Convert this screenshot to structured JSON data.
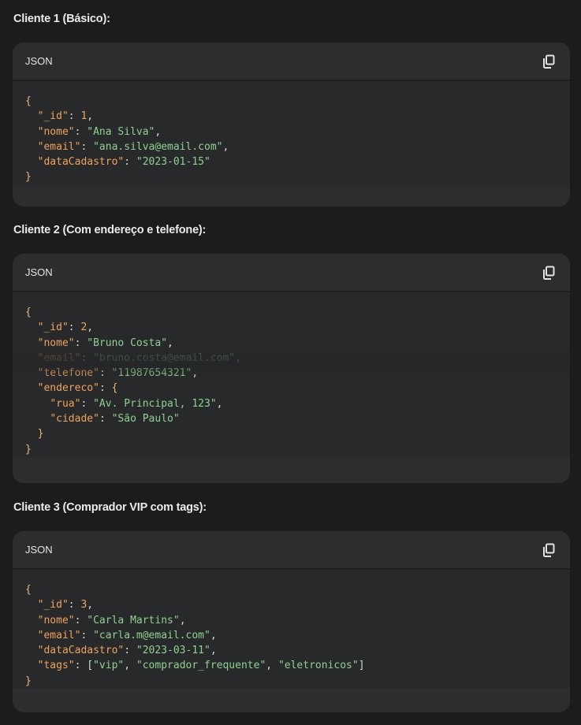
{
  "sections": [
    {
      "title": "Cliente 1 (Básico):",
      "lang": "JSON",
      "copy_icon": "copy-icon",
      "lines": [
        [
          {
            "t": "{",
            "c": "brace"
          }
        ],
        [
          {
            "t": "  "
          },
          {
            "t": "\"_id\"",
            "c": "k"
          },
          {
            "t": ": ",
            "c": "p"
          },
          {
            "t": "1",
            "c": "n"
          },
          {
            "t": ",",
            "c": "p"
          }
        ],
        [
          {
            "t": "  "
          },
          {
            "t": "\"nome\"",
            "c": "k"
          },
          {
            "t": ": ",
            "c": "p"
          },
          {
            "t": "\"Ana Silva\"",
            "c": "s"
          },
          {
            "t": ",",
            "c": "p"
          }
        ],
        [
          {
            "t": "  "
          },
          {
            "t": "\"email\"",
            "c": "k"
          },
          {
            "t": ": ",
            "c": "p"
          },
          {
            "t": "\"ana.silva@email.com\"",
            "c": "s"
          },
          {
            "t": ",",
            "c": "p"
          }
        ],
        [
          {
            "t": "  "
          },
          {
            "t": "\"dataCadastro\"",
            "c": "k"
          },
          {
            "t": ": ",
            "c": "p"
          },
          {
            "t": "\"2023-01-15\"",
            "c": "s"
          }
        ],
        [
          {
            "t": "}",
            "c": "brace"
          }
        ]
      ]
    },
    {
      "title": "Cliente 2 (Com endereço e telefone):",
      "lang": "JSON",
      "copy_icon": "copy-icon",
      "lines": [
        [
          {
            "t": "{",
            "c": "brace"
          }
        ],
        [
          {
            "t": "  "
          },
          {
            "t": "\"_id\"",
            "c": "k"
          },
          {
            "t": ": ",
            "c": "p"
          },
          {
            "t": "2",
            "c": "n"
          },
          {
            "t": ",",
            "c": "p"
          }
        ],
        [
          {
            "t": "  "
          },
          {
            "t": "\"nome\"",
            "c": "k"
          },
          {
            "t": ": ",
            "c": "p"
          },
          {
            "t": "\"Bruno Costa\"",
            "c": "s"
          },
          {
            "t": ",",
            "c": "p"
          }
        ],
        [
          {
            "t": "  "
          },
          {
            "t": "\"email\"",
            "c": "k"
          },
          {
            "t": ": ",
            "c": "p"
          },
          {
            "t": "\"bruno.costa@email.com\"",
            "c": "s"
          },
          {
            "t": ",",
            "c": "p"
          }
        ],
        [
          {
            "t": "  "
          },
          {
            "t": "\"telefone\"",
            "c": "k"
          },
          {
            "t": ": ",
            "c": "p"
          },
          {
            "t": "\"11987654321\"",
            "c": "s"
          },
          {
            "t": ",",
            "c": "p"
          }
        ],
        [
          {
            "t": "  "
          },
          {
            "t": "\"endereco\"",
            "c": "k"
          },
          {
            "t": ": ",
            "c": "p"
          },
          {
            "t": "{",
            "c": "brace"
          }
        ],
        [
          {
            "t": "    "
          },
          {
            "t": "\"rua\"",
            "c": "k"
          },
          {
            "t": ": ",
            "c": "p"
          },
          {
            "t": "\"Av. Principal, 123\"",
            "c": "s"
          },
          {
            "t": ",",
            "c": "p"
          }
        ],
        [
          {
            "t": "    "
          },
          {
            "t": "\"cidade\"",
            "c": "k"
          },
          {
            "t": ": ",
            "c": "p"
          },
          {
            "t": "\"São Paulo\"",
            "c": "s"
          }
        ],
        [
          {
            "t": "  "
          },
          {
            "t": "}",
            "c": "brace"
          }
        ],
        [
          {
            "t": "}",
            "c": "brace"
          }
        ]
      ]
    },
    {
      "title": "Cliente 3 (Comprador VIP com tags):",
      "lang": "JSON",
      "copy_icon": "copy-icon",
      "lines": [
        [
          {
            "t": "{",
            "c": "brace"
          }
        ],
        [
          {
            "t": "  "
          },
          {
            "t": "\"_id\"",
            "c": "k"
          },
          {
            "t": ": ",
            "c": "p"
          },
          {
            "t": "3",
            "c": "n"
          },
          {
            "t": ",",
            "c": "p"
          }
        ],
        [
          {
            "t": "  "
          },
          {
            "t": "\"nome\"",
            "c": "k"
          },
          {
            "t": ": ",
            "c": "p"
          },
          {
            "t": "\"Carla Martins\"",
            "c": "s"
          },
          {
            "t": ",",
            "c": "p"
          }
        ],
        [
          {
            "t": "  "
          },
          {
            "t": "\"email\"",
            "c": "k"
          },
          {
            "t": ": ",
            "c": "p"
          },
          {
            "t": "\"carla.m@email.com\"",
            "c": "s"
          },
          {
            "t": ",",
            "c": "p"
          }
        ],
        [
          {
            "t": "  "
          },
          {
            "t": "\"dataCadastro\"",
            "c": "k"
          },
          {
            "t": ": ",
            "c": "p"
          },
          {
            "t": "\"2023-03-11\"",
            "c": "s"
          },
          {
            "t": ",",
            "c": "p"
          }
        ],
        [
          {
            "t": "  "
          },
          {
            "t": "\"tags\"",
            "c": "k"
          },
          {
            "t": ": ",
            "c": "p"
          },
          {
            "t": "[",
            "c": "p"
          },
          {
            "t": "\"vip\"",
            "c": "s"
          },
          {
            "t": ", ",
            "c": "p"
          },
          {
            "t": "\"comprador_frequente\"",
            "c": "s"
          },
          {
            "t": ", ",
            "c": "p"
          },
          {
            "t": "\"eletronicos\"",
            "c": "s"
          },
          {
            "t": "]",
            "c": "p"
          }
        ],
        [
          {
            "t": "}",
            "c": "brace"
          }
        ]
      ]
    }
  ]
}
